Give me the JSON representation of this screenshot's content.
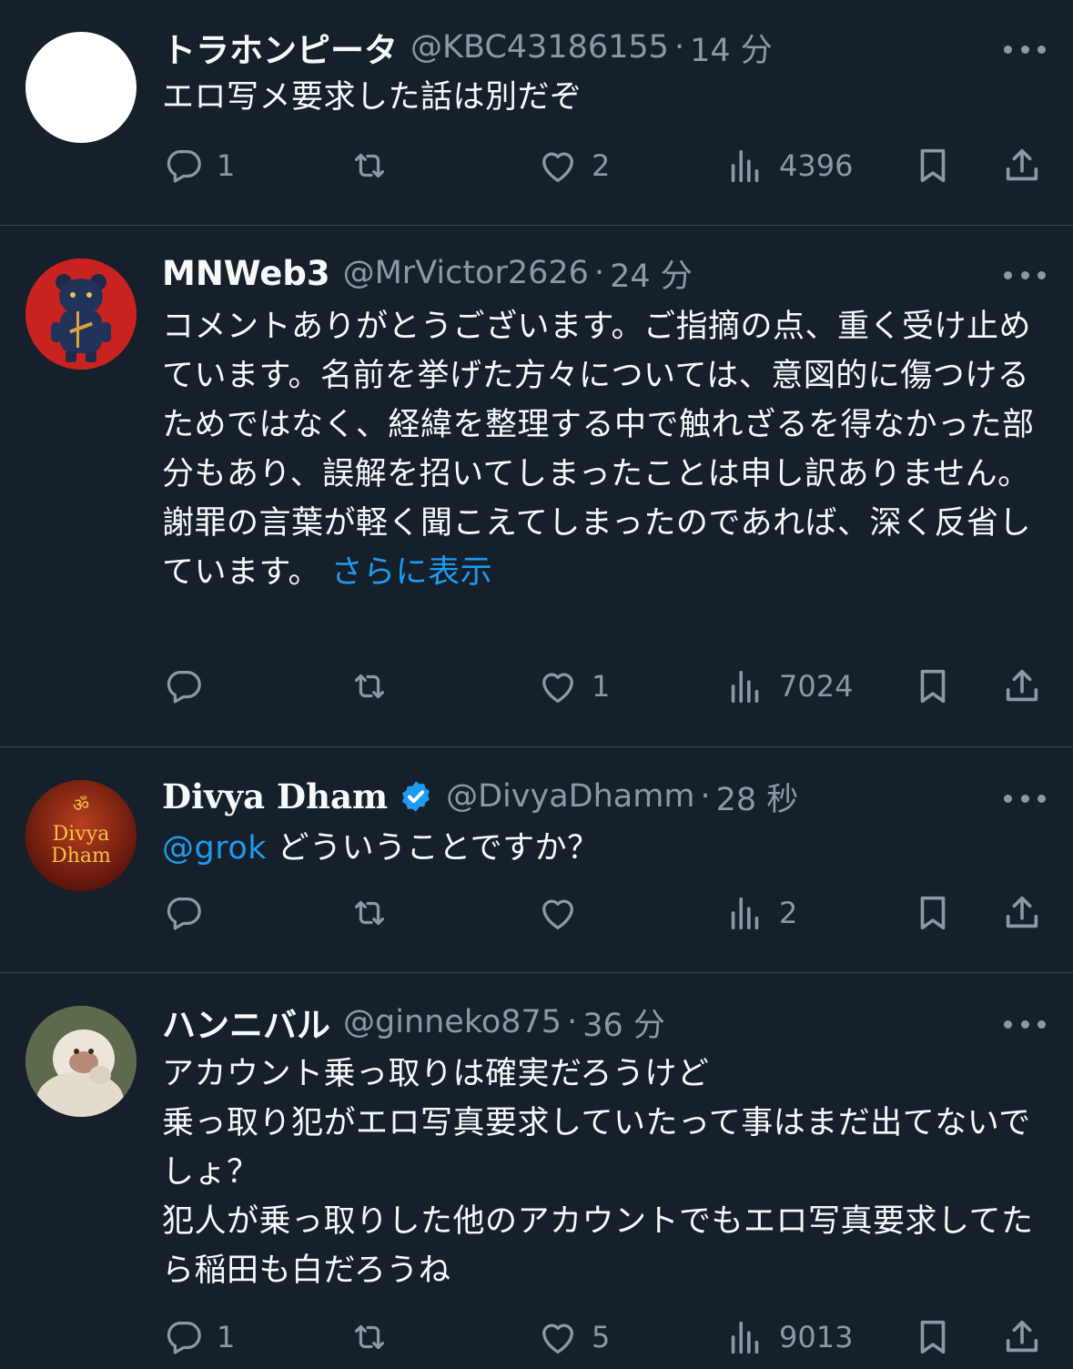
{
  "tweets": [
    {
      "name": "トラホンピータ",
      "handle": "@KBC43186155",
      "time": "14 分",
      "body": "エロ写メ要求した話は別だぞ",
      "replies": "1",
      "retweets": "",
      "likes": "2",
      "views": "4396"
    },
    {
      "name": "MNWeb3",
      "handle": "@MrVictor2626",
      "time": "24 分",
      "body": "コメントありがとうございます。ご指摘の点、重く受け止めています。名前を挙げた方々については、意図的に傷つけるためではなく、経緯を整理する中で触れざるを得なかった部分もあり、誤解を招いてしまったことは申し訳ありません。謝罪の言葉が軽く聞こえてしまったのであれば、深く反省しています。",
      "show_more": "さらに表示",
      "replies": "",
      "retweets": "",
      "likes": "1",
      "views": "7024"
    },
    {
      "name": "Divya Dham",
      "handle": "@DivyaDhamm",
      "time": "28 秒",
      "mention": "@grok",
      "body": " どういうことですか？",
      "avatar_text_1": "Divya",
      "avatar_text_2": "Dham",
      "avatar_symbol": "ॐ",
      "replies": "",
      "retweets": "",
      "likes": "",
      "views": "2"
    },
    {
      "name": "ハンニバル",
      "handle": "@ginneko875",
      "time": "36 分",
      "body": "アカウント乗っ取りは確実だろうけど\n乗っ取り犯がエロ写真要求していたって事はまだ出てないでしょ？\n犯人が乗っ取りした他のアカウントでもエロ写真要求してたら稲田も白だろうね",
      "replies": "1",
      "retweets": "",
      "likes": "5",
      "views": "9013"
    }
  ],
  "colors": {
    "background": "#15202b",
    "text": "#f7f9f9",
    "muted": "#8b98a5",
    "link": "#1d9bf0",
    "divider": "#38444d"
  }
}
